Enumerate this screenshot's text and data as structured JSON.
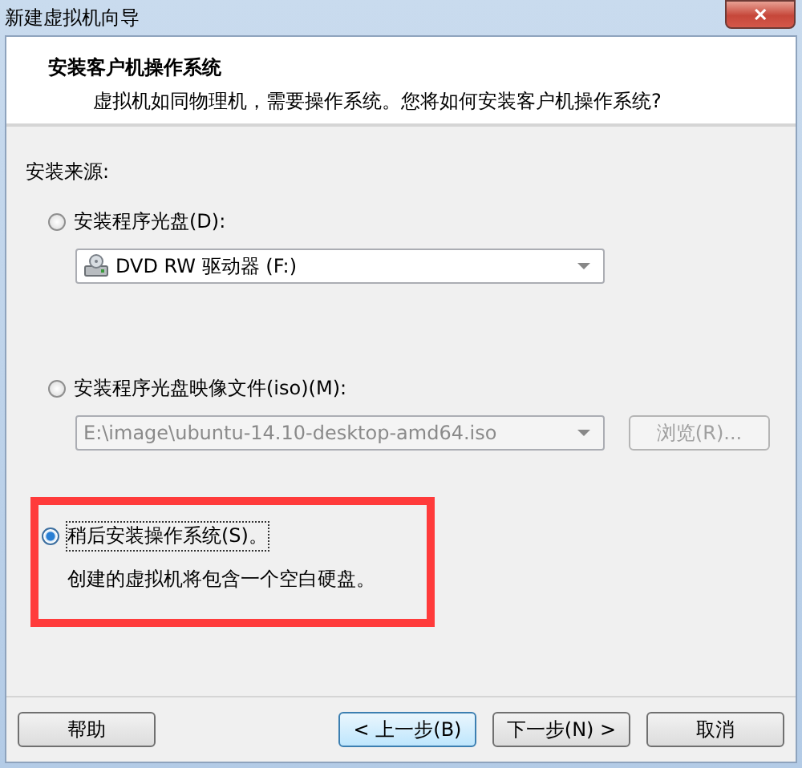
{
  "window": {
    "title": "新建虚拟机向导",
    "close": "✕"
  },
  "header": {
    "title": "安装客户机操作系统",
    "subtitle": "虚拟机如同物理机，需要操作系统。您将如何安装客户机操作系统?"
  },
  "source_label": "安装来源:",
  "options": [
    {
      "kind": "disc",
      "label": "安装程序光盘(D):",
      "selected": false,
      "highlighted": false,
      "value": "DVD RW 驱动器 (F:)",
      "disabled": false
    },
    {
      "kind": "iso",
      "label": "安装程序光盘映像文件(iso)(M):",
      "selected": false,
      "highlighted": false,
      "value": "E:\\image\\ubuntu-14.10-desktop-amd64.iso",
      "disabled": true,
      "browse": "浏览(R)..."
    },
    {
      "kind": "later",
      "label": "稍后安装操作系统(S)。",
      "selected": true,
      "highlighted": true,
      "description": "创建的虚拟机将包含一个空白硬盘。"
    }
  ],
  "buttons": [
    {
      "label": "帮助",
      "kind": "help"
    },
    {
      "label": "< 上一步(B)",
      "kind": "nav"
    },
    {
      "label": "下一步(N) >",
      "kind": "nav"
    },
    {
      "label": "取消",
      "kind": "nav"
    }
  ]
}
